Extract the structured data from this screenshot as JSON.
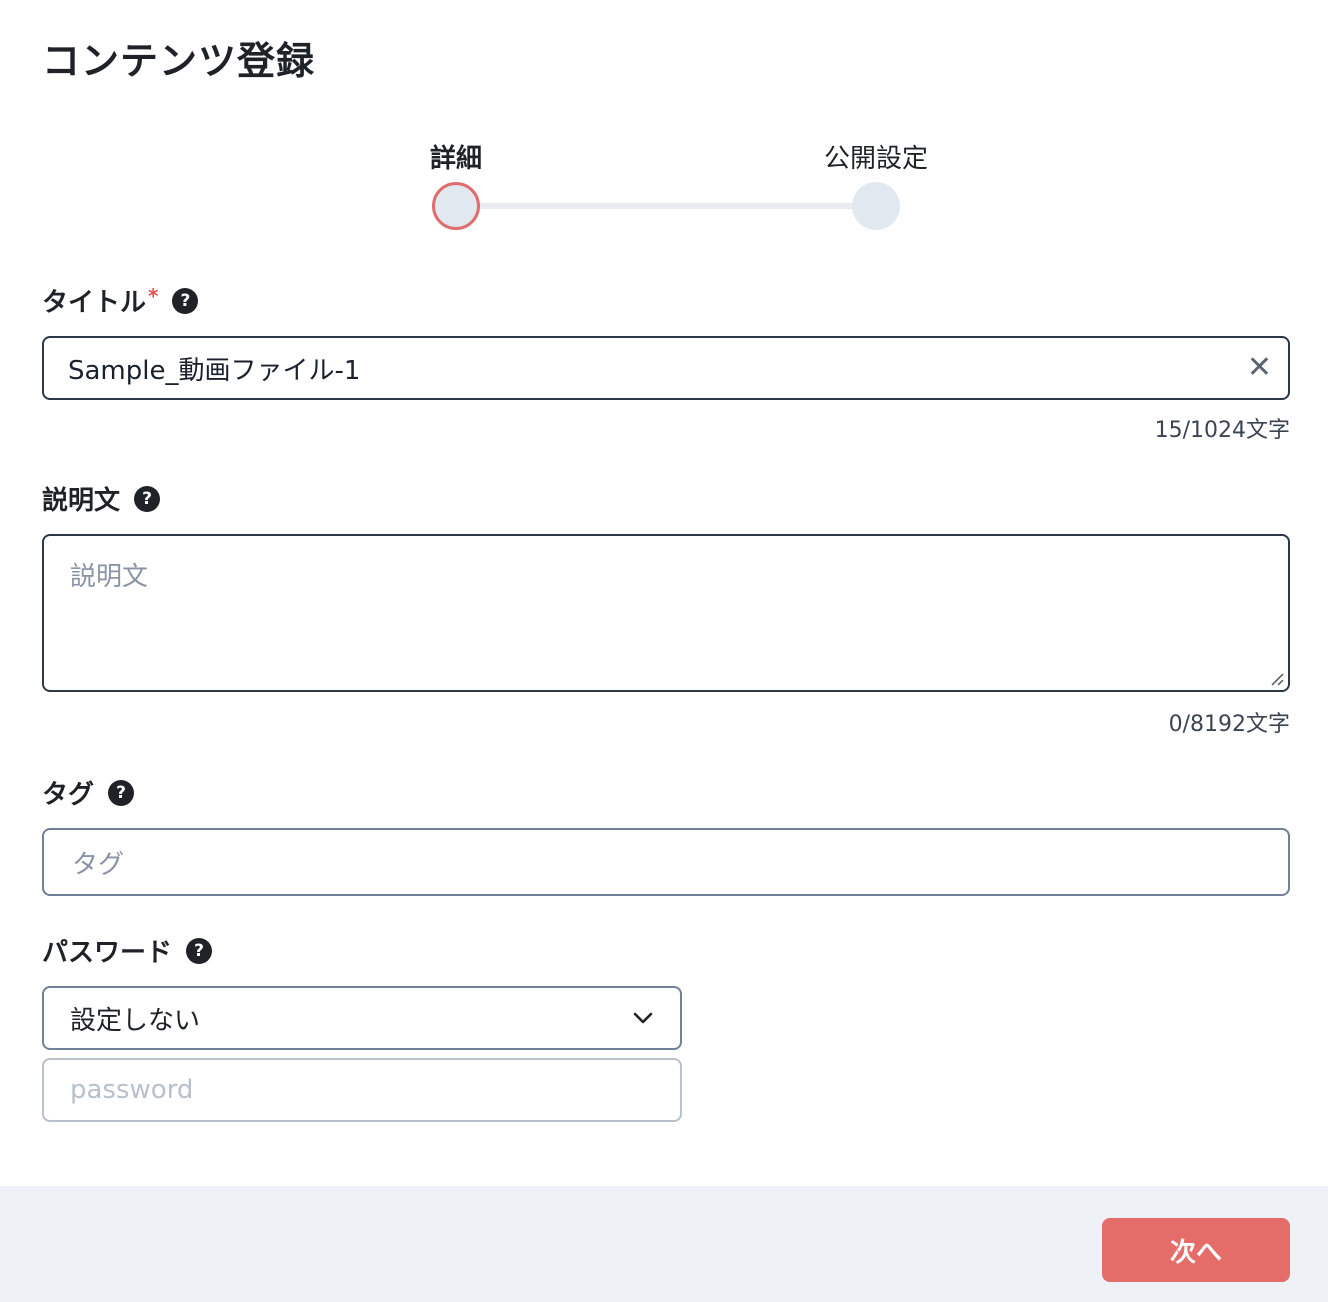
{
  "header": {
    "title": "コンテンツ登録"
  },
  "stepper": {
    "steps": [
      {
        "label": "詳細",
        "active": true
      },
      {
        "label": "公開設定",
        "active": false
      }
    ]
  },
  "title_field": {
    "label": "タイトル",
    "required_mark": "*",
    "help": "?",
    "value": "Sample_動画ファイル-1",
    "clear": "✕",
    "counter": "15/1024文字"
  },
  "description_field": {
    "label": "説明文",
    "help": "?",
    "placeholder": "説明文",
    "counter": "0/8192文字"
  },
  "tag_field": {
    "label": "タグ",
    "help": "?",
    "placeholder": "タグ"
  },
  "password_field": {
    "label": "パスワード",
    "help": "?",
    "selected": "設定しない",
    "placeholder": "password"
  },
  "footer": {
    "next_label": "次へ"
  },
  "colors": {
    "accent": "#e46d6a",
    "footer_bg": "#eef1f6",
    "step_inactive": "#e2e8f0"
  }
}
